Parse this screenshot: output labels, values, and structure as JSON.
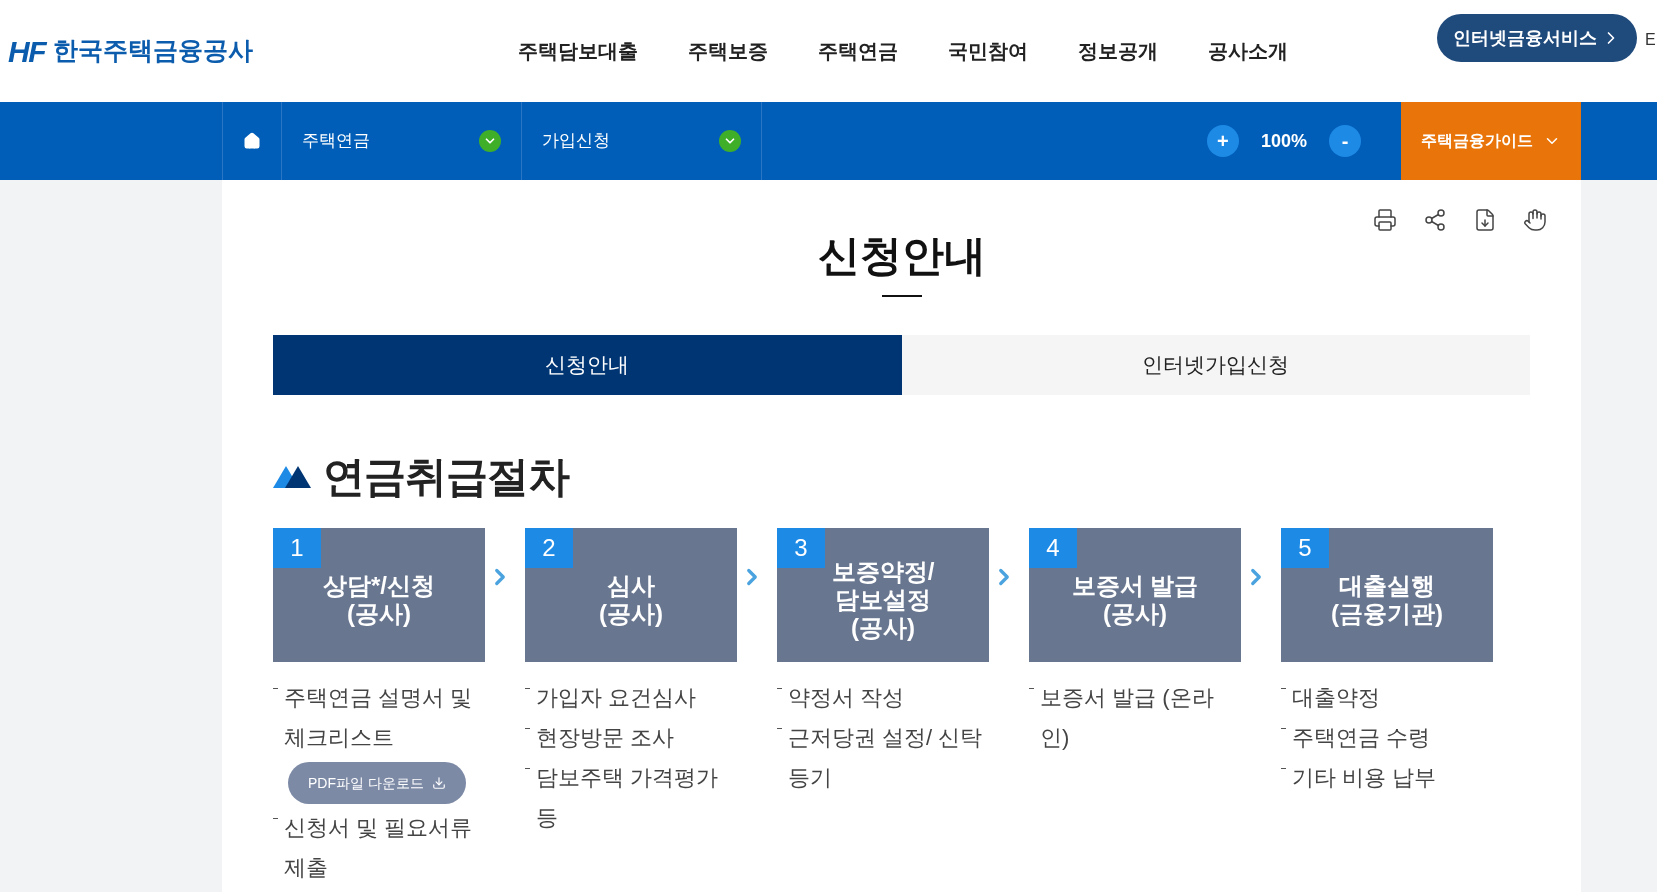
{
  "header": {
    "logo_mark": "HF",
    "logo_text": "한국주택금융공사",
    "menu": [
      "주택담보대출",
      "주택보증",
      "주택연금",
      "국민참여",
      "정보공개",
      "공사소개"
    ],
    "service_button": "인터넷금융서비스",
    "edge_text": "E"
  },
  "breadcrumb": {
    "items": [
      "주택연금",
      "가입신청"
    ],
    "zoom_in": "+",
    "zoom": "100%",
    "zoom_out": "-",
    "guide": "주택금융가이드"
  },
  "page": {
    "title": "신청안내",
    "tabs": [
      {
        "label": "신청안내",
        "selected": true
      },
      {
        "label": "인터넷가입신청",
        "selected": false
      }
    ],
    "section_title": "연금취급절차",
    "steps": [
      {
        "number": "1",
        "title": [
          "상담*/신청",
          "(공사)"
        ],
        "items": [
          {
            "kind": "text",
            "text": "주택연금 설명서 및 체크리스트"
          },
          {
            "kind": "download",
            "text": "PDF파일 다운로드"
          },
          {
            "kind": "text",
            "text": "신청서 및 필요서류 제출"
          }
        ]
      },
      {
        "number": "2",
        "title": [
          "심사",
          "(공사)"
        ],
        "items": [
          {
            "kind": "text",
            "text": "가입자 요건심사"
          },
          {
            "kind": "text",
            "text": "현장방문 조사"
          },
          {
            "kind": "text",
            "text": "담보주택 가격평가 등"
          }
        ]
      },
      {
        "number": "3",
        "title": [
          "보증약정/",
          "담보설정",
          "(공사)"
        ],
        "items": [
          {
            "kind": "text",
            "text": "약정서 작성"
          },
          {
            "kind": "text",
            "text": "근저당권 설정/ 신탁등기"
          }
        ]
      },
      {
        "number": "4",
        "title": [
          "보증서 발급",
          "(공사)"
        ],
        "items": [
          {
            "kind": "text",
            "text": "보증서 발급 (온라인)"
          }
        ]
      },
      {
        "number": "5",
        "title": [
          "대출실행",
          "(금융기관)"
        ],
        "items": [
          {
            "kind": "text",
            "text": "대출약정"
          },
          {
            "kind": "text",
            "text": "주택연금 수령"
          },
          {
            "kind": "text",
            "text": "기타 비용 납부"
          }
        ]
      }
    ]
  }
}
